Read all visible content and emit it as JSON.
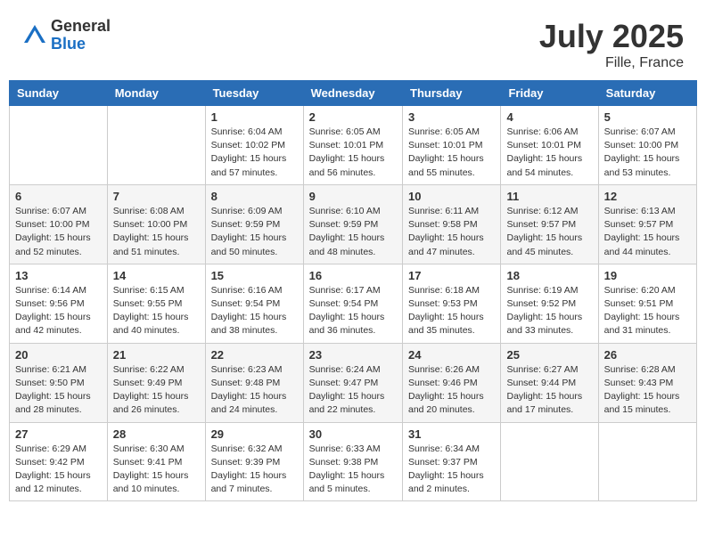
{
  "logo": {
    "general": "General",
    "blue": "Blue"
  },
  "title": "July 2025",
  "location": "Fille, France",
  "days_of_week": [
    "Sunday",
    "Monday",
    "Tuesday",
    "Wednesday",
    "Thursday",
    "Friday",
    "Saturday"
  ],
  "weeks": [
    [
      {
        "day": "",
        "info": ""
      },
      {
        "day": "",
        "info": ""
      },
      {
        "day": "1",
        "info": "Sunrise: 6:04 AM\nSunset: 10:02 PM\nDaylight: 15 hours and 57 minutes."
      },
      {
        "day": "2",
        "info": "Sunrise: 6:05 AM\nSunset: 10:01 PM\nDaylight: 15 hours and 56 minutes."
      },
      {
        "day": "3",
        "info": "Sunrise: 6:05 AM\nSunset: 10:01 PM\nDaylight: 15 hours and 55 minutes."
      },
      {
        "day": "4",
        "info": "Sunrise: 6:06 AM\nSunset: 10:01 PM\nDaylight: 15 hours and 54 minutes."
      },
      {
        "day": "5",
        "info": "Sunrise: 6:07 AM\nSunset: 10:00 PM\nDaylight: 15 hours and 53 minutes."
      }
    ],
    [
      {
        "day": "6",
        "info": "Sunrise: 6:07 AM\nSunset: 10:00 PM\nDaylight: 15 hours and 52 minutes."
      },
      {
        "day": "7",
        "info": "Sunrise: 6:08 AM\nSunset: 10:00 PM\nDaylight: 15 hours and 51 minutes."
      },
      {
        "day": "8",
        "info": "Sunrise: 6:09 AM\nSunset: 9:59 PM\nDaylight: 15 hours and 50 minutes."
      },
      {
        "day": "9",
        "info": "Sunrise: 6:10 AM\nSunset: 9:59 PM\nDaylight: 15 hours and 48 minutes."
      },
      {
        "day": "10",
        "info": "Sunrise: 6:11 AM\nSunset: 9:58 PM\nDaylight: 15 hours and 47 minutes."
      },
      {
        "day": "11",
        "info": "Sunrise: 6:12 AM\nSunset: 9:57 PM\nDaylight: 15 hours and 45 minutes."
      },
      {
        "day": "12",
        "info": "Sunrise: 6:13 AM\nSunset: 9:57 PM\nDaylight: 15 hours and 44 minutes."
      }
    ],
    [
      {
        "day": "13",
        "info": "Sunrise: 6:14 AM\nSunset: 9:56 PM\nDaylight: 15 hours and 42 minutes."
      },
      {
        "day": "14",
        "info": "Sunrise: 6:15 AM\nSunset: 9:55 PM\nDaylight: 15 hours and 40 minutes."
      },
      {
        "day": "15",
        "info": "Sunrise: 6:16 AM\nSunset: 9:54 PM\nDaylight: 15 hours and 38 minutes."
      },
      {
        "day": "16",
        "info": "Sunrise: 6:17 AM\nSunset: 9:54 PM\nDaylight: 15 hours and 36 minutes."
      },
      {
        "day": "17",
        "info": "Sunrise: 6:18 AM\nSunset: 9:53 PM\nDaylight: 15 hours and 35 minutes."
      },
      {
        "day": "18",
        "info": "Sunrise: 6:19 AM\nSunset: 9:52 PM\nDaylight: 15 hours and 33 minutes."
      },
      {
        "day": "19",
        "info": "Sunrise: 6:20 AM\nSunset: 9:51 PM\nDaylight: 15 hours and 31 minutes."
      }
    ],
    [
      {
        "day": "20",
        "info": "Sunrise: 6:21 AM\nSunset: 9:50 PM\nDaylight: 15 hours and 28 minutes."
      },
      {
        "day": "21",
        "info": "Sunrise: 6:22 AM\nSunset: 9:49 PM\nDaylight: 15 hours and 26 minutes."
      },
      {
        "day": "22",
        "info": "Sunrise: 6:23 AM\nSunset: 9:48 PM\nDaylight: 15 hours and 24 minutes."
      },
      {
        "day": "23",
        "info": "Sunrise: 6:24 AM\nSunset: 9:47 PM\nDaylight: 15 hours and 22 minutes."
      },
      {
        "day": "24",
        "info": "Sunrise: 6:26 AM\nSunset: 9:46 PM\nDaylight: 15 hours and 20 minutes."
      },
      {
        "day": "25",
        "info": "Sunrise: 6:27 AM\nSunset: 9:44 PM\nDaylight: 15 hours and 17 minutes."
      },
      {
        "day": "26",
        "info": "Sunrise: 6:28 AM\nSunset: 9:43 PM\nDaylight: 15 hours and 15 minutes."
      }
    ],
    [
      {
        "day": "27",
        "info": "Sunrise: 6:29 AM\nSunset: 9:42 PM\nDaylight: 15 hours and 12 minutes."
      },
      {
        "day": "28",
        "info": "Sunrise: 6:30 AM\nSunset: 9:41 PM\nDaylight: 15 hours and 10 minutes."
      },
      {
        "day": "29",
        "info": "Sunrise: 6:32 AM\nSunset: 9:39 PM\nDaylight: 15 hours and 7 minutes."
      },
      {
        "day": "30",
        "info": "Sunrise: 6:33 AM\nSunset: 9:38 PM\nDaylight: 15 hours and 5 minutes."
      },
      {
        "day": "31",
        "info": "Sunrise: 6:34 AM\nSunset: 9:37 PM\nDaylight: 15 hours and 2 minutes."
      },
      {
        "day": "",
        "info": ""
      },
      {
        "day": "",
        "info": ""
      }
    ]
  ]
}
